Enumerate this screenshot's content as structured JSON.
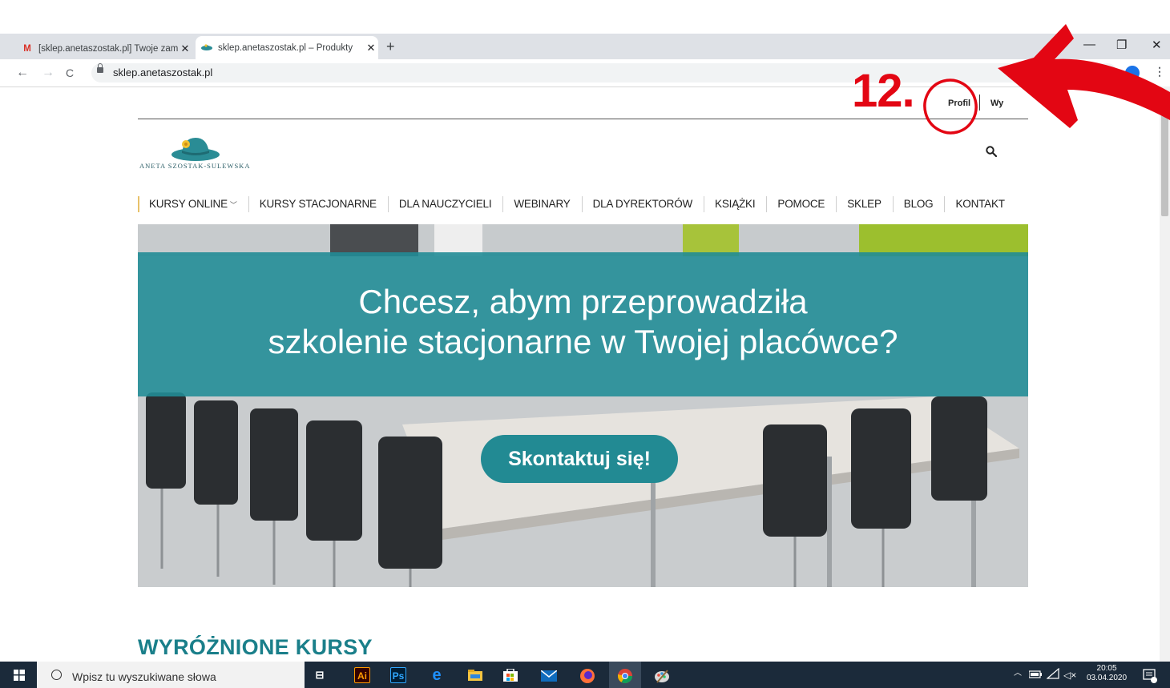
{
  "browser": {
    "tabs": [
      {
        "favicon": "gmail-icon",
        "title": "[sklep.anetaszostak.pl] Twoje zam"
      },
      {
        "favicon": "site-icon",
        "title": "sklep.anetaszostak.pl – Produkty"
      }
    ],
    "url": "sklep.anetaszostak.pl",
    "new_tab_label": "+",
    "close_glyph": "✕",
    "window_controls": {
      "minimize": "—",
      "maximize": "❐",
      "close": "✕"
    },
    "nav": {
      "back": "←",
      "forward": "→",
      "reload": "C",
      "menu": "⋮"
    }
  },
  "site": {
    "account": {
      "profile_label": "Profil",
      "logout_label": "Wy"
    },
    "logo_text": "ANETA SZOSTAK-SULEWSKA",
    "nav_items": [
      "KURSY ONLINE",
      "KURSY STACJONARNE",
      "DLA NAUCZYCIELI",
      "WEBINARY",
      "DLA DYREKTORÓW",
      "KSIĄŻKI",
      "POMOCE",
      "SKLEP",
      "BLOG",
      "KONTAKT"
    ],
    "nav_dropdown_glyph": "﹀",
    "hero": {
      "title_line1": "Chcesz, abym przeprowadziła",
      "title_line2": "szkolenie stacjonarne w Twojej placówce?",
      "cta_label": "Skontaktuj się!"
    },
    "featured_title": "WYRÓŻNIONE KURSY"
  },
  "annotation": {
    "step_label": "12.",
    "color": "#e30613"
  },
  "taskbar": {
    "search_placeholder": "Wpisz tu wyszukiwane słowa",
    "apps": [
      "task-view-icon",
      "illustrator-icon",
      "photoshop-icon",
      "edge-icon",
      "file-explorer-icon",
      "store-icon",
      "mail-icon",
      "firefox-icon",
      "chrome-icon",
      "paint-icon"
    ],
    "illustrator_label": "Ai",
    "photoshop_label": "Ps",
    "time": "20:05",
    "date": "03.04.2020"
  },
  "colors": {
    "accent_teal": "#228a93",
    "heading_teal": "#1a7f8a",
    "annotation_red": "#e30613"
  }
}
